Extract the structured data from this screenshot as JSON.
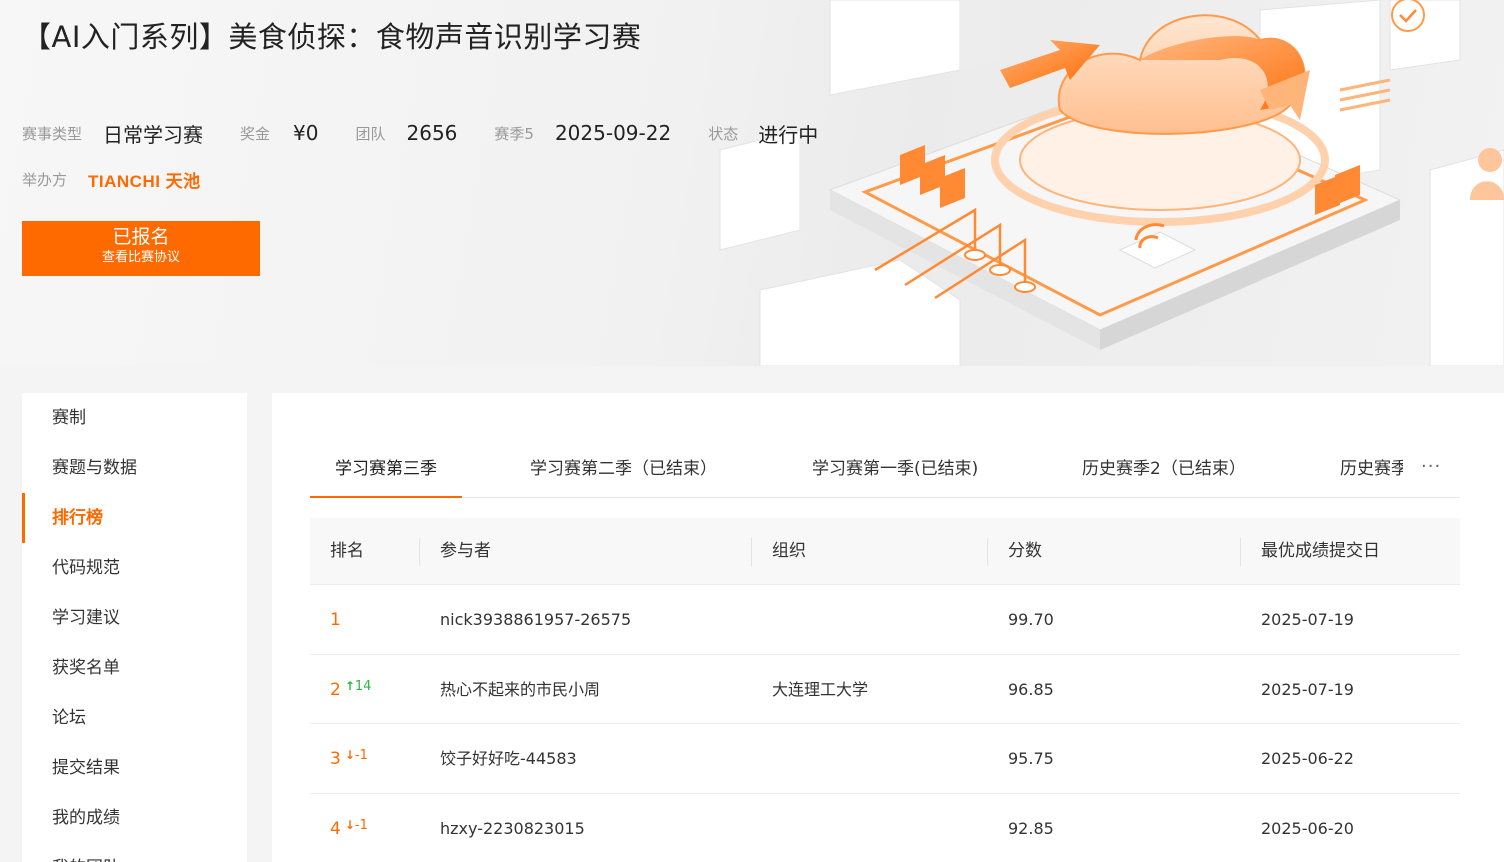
{
  "competition": {
    "title": "【AI入门系列】美食侦探：食物声音识别学习赛",
    "meta": [
      {
        "label": "赛事类型",
        "value": "日常学习赛"
      },
      {
        "label": "奖金",
        "value": "¥0"
      },
      {
        "label": "团队",
        "value": "2656"
      },
      {
        "label": "赛季5",
        "value": "2025-09-22"
      },
      {
        "label": "状态",
        "value": "进行中"
      }
    ],
    "organizer_label": "举办方",
    "organizer_logo_text": "TIANCHI 天池",
    "signup_main": "已报名",
    "signup_sub": "查看比赛协议"
  },
  "sidebar": {
    "items": [
      {
        "label": "赛制",
        "active": false
      },
      {
        "label": "赛题与数据",
        "active": false
      },
      {
        "label": "排行榜",
        "active": true
      },
      {
        "label": "代码规范",
        "active": false
      },
      {
        "label": "学习建议",
        "active": false
      },
      {
        "label": "获奖名单",
        "active": false
      },
      {
        "label": "论坛",
        "active": false
      },
      {
        "label": "提交结果",
        "active": false
      },
      {
        "label": "我的成绩",
        "active": false
      },
      {
        "label": "我的团队",
        "active": false
      }
    ]
  },
  "tabs": {
    "items": [
      {
        "label": "学习赛第三季",
        "active": true
      },
      {
        "label": "学习赛第二季（已结束）",
        "active": false
      },
      {
        "label": "学习赛第一季(已结束)",
        "active": false
      },
      {
        "label": "历史赛季2（已结束）",
        "active": false
      },
      {
        "label": "历史赛季",
        "active": false
      }
    ],
    "more_label": "···"
  },
  "leaderboard": {
    "columns": [
      "排名",
      "参与者",
      "组织",
      "分数",
      "最优成绩提交日"
    ],
    "rows": [
      {
        "rank": "1",
        "delta": "",
        "direction": "",
        "participant": "nick3938861957-26575",
        "organization": "",
        "score": "99.70",
        "date": "2025-07-19"
      },
      {
        "rank": "2",
        "delta": "14",
        "direction": "up",
        "participant": "热心不起来的市民小周",
        "organization": "大连理工大学",
        "score": "96.85",
        "date": "2025-07-19"
      },
      {
        "rank": "3",
        "delta": "-1",
        "direction": "down",
        "participant": "饺子好好吃-44583",
        "organization": "",
        "score": "95.75",
        "date": "2025-06-22"
      },
      {
        "rank": "4",
        "delta": "-1",
        "direction": "down",
        "participant": "hzxy-2230823015",
        "organization": "",
        "score": "92.85",
        "date": "2025-06-20"
      }
    ]
  },
  "colors": {
    "accent": "#ff6a00",
    "up": "#2db73f",
    "down": "#ff6a00"
  },
  "icons": {
    "up": "↑",
    "down": "↓"
  }
}
